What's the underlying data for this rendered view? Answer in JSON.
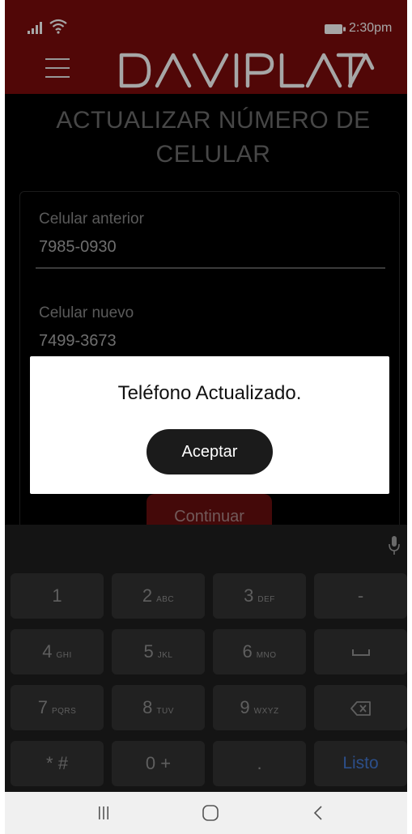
{
  "status_bar": {
    "time": "2:30pm",
    "icons": [
      "signal-icon",
      "wifi-icon",
      "battery-icon"
    ]
  },
  "header": {
    "logo_text": "DAVIPLATA",
    "menu_icon": "hamburger-menu-icon"
  },
  "page": {
    "title_line1": "ACTUALIZAR NÚMERO DE",
    "title_line2": "CELULAR"
  },
  "form": {
    "previous_label": "Celular anterior",
    "previous_value": "7985-0930",
    "new_label": "Celular nuevo",
    "new_value": "7499-3673",
    "continue_label": "Continuar"
  },
  "dialog": {
    "message": "Teléfono Actualizado.",
    "accept_label": "Aceptar"
  },
  "keyboard": {
    "rows": [
      [
        {
          "main": "1",
          "sub": ""
        },
        {
          "main": "2",
          "sub": "ABC"
        },
        {
          "main": "3",
          "sub": "DEF"
        },
        {
          "main": "-",
          "sub": ""
        }
      ],
      [
        {
          "main": "4",
          "sub": "GHI"
        },
        {
          "main": "5",
          "sub": "JKL"
        },
        {
          "main": "6",
          "sub": "MNO"
        },
        {
          "main": "space-icon",
          "sub": ""
        }
      ],
      [
        {
          "main": "7",
          "sub": "PQRS"
        },
        {
          "main": "8",
          "sub": "TUV"
        },
        {
          "main": "9",
          "sub": "WXYZ"
        },
        {
          "main": "backspace-icon",
          "sub": ""
        }
      ],
      [
        {
          "main": "* #",
          "sub": ""
        },
        {
          "main": "0 +",
          "sub": ""
        },
        {
          "main": ".",
          "sub": ""
        },
        {
          "main": "Listo",
          "sub": ""
        }
      ]
    ]
  },
  "nav_bar": {
    "icons": [
      "recent-apps-icon",
      "home-icon",
      "back-icon"
    ]
  },
  "colors": {
    "brand": "#7d0b0b",
    "background": "#000000",
    "dialog": "#ffffff",
    "done_key": "#2c4f8a"
  }
}
